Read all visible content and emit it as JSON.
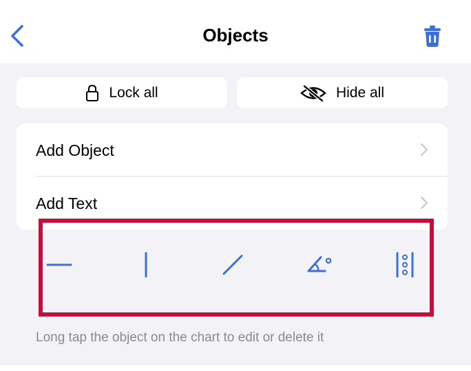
{
  "nav": {
    "title": "Objects",
    "back_icon": "chevron-left-icon",
    "delete_icon": "trash-icon"
  },
  "actions": {
    "lock_all": "Lock all",
    "hide_all": "Hide all"
  },
  "menu": {
    "items": [
      {
        "label": "Add Object"
      },
      {
        "label": "Add Text"
      }
    ]
  },
  "toolbar": {
    "tools": [
      "horizontal-line-icon",
      "vertical-line-icon",
      "trend-line-icon",
      "angle-icon",
      "parallel-channel-icon"
    ]
  },
  "hint": "Long tap the object on the chart to edit or delete it",
  "colors": {
    "accent": "#3b6fd9",
    "highlight": "#c70d3a",
    "background": "#f2f2f7"
  }
}
